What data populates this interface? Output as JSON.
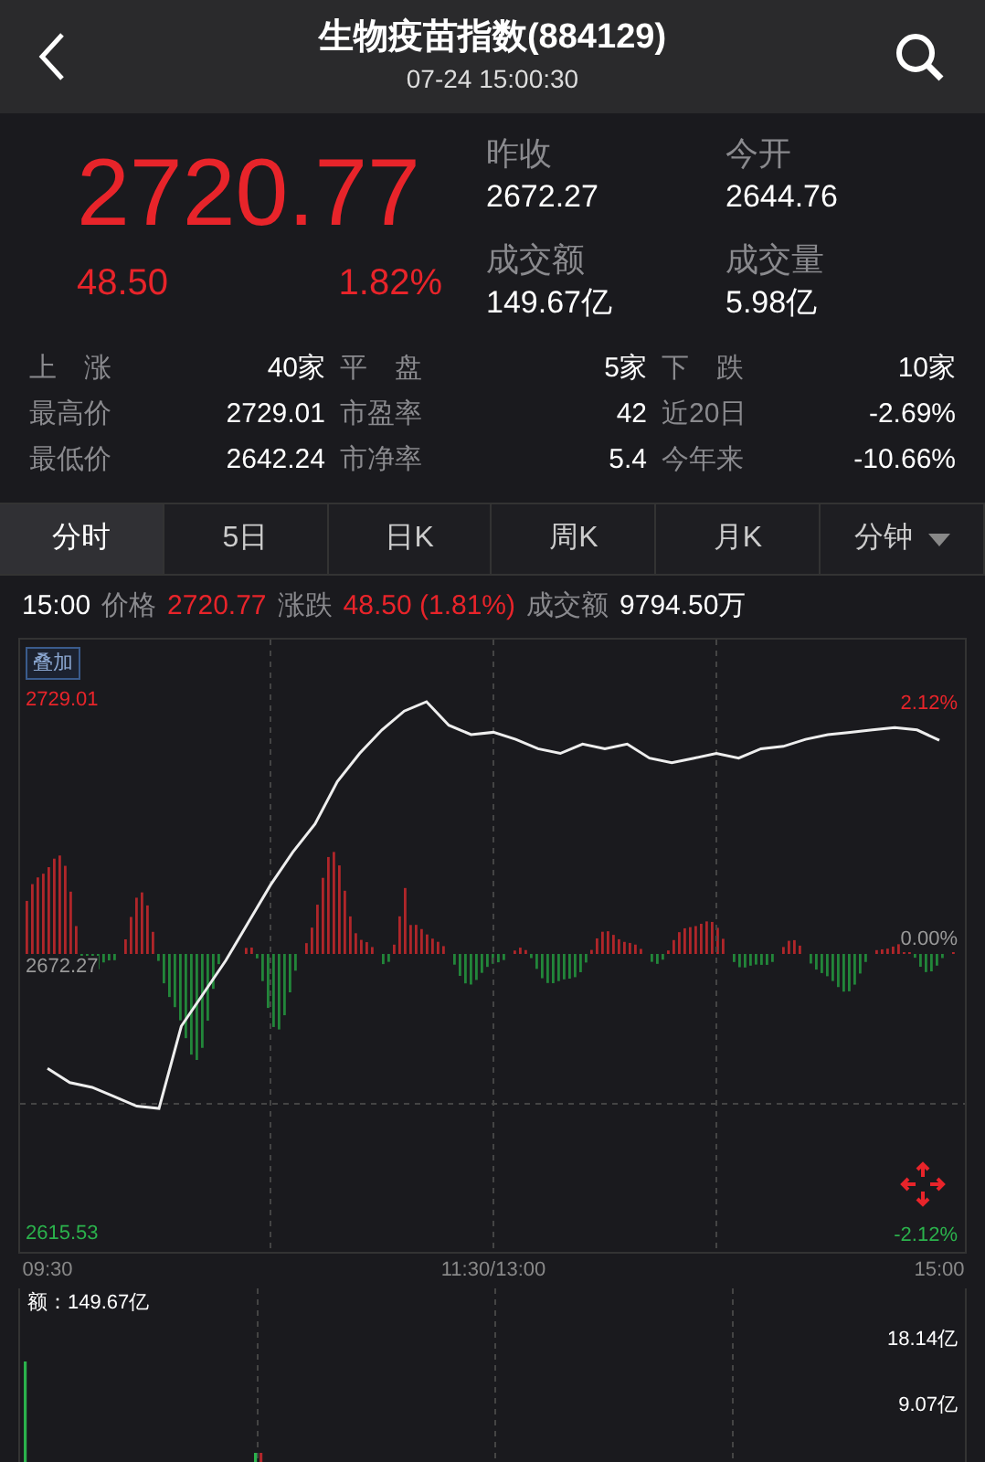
{
  "header": {
    "title": "生物疫苗指数(884129)",
    "datetime": "07-24 15:00:30"
  },
  "quote": {
    "price": "2720.77",
    "change": "48.50",
    "change_pct": "1.82%"
  },
  "stats": [
    {
      "label": "昨收",
      "value": "2672.27"
    },
    {
      "label": "今开",
      "value": "2644.76"
    },
    {
      "label": "成交额",
      "value": "149.67亿"
    },
    {
      "label": "成交量",
      "value": "5.98亿"
    }
  ],
  "breadth": [
    [
      {
        "label": "上　涨",
        "value": "40家"
      },
      {
        "label": "平　盘",
        "value": "5家"
      },
      {
        "label": "下　跌",
        "value": "10家"
      }
    ],
    [
      {
        "label": "最高价",
        "value": "2729.01"
      },
      {
        "label": "市盈率",
        "value": "42"
      },
      {
        "label": "近20日",
        "value": "-2.69%"
      }
    ],
    [
      {
        "label": "最低价",
        "value": "2642.24"
      },
      {
        "label": "市净率",
        "value": "5.4"
      },
      {
        "label": "今年来",
        "value": "-10.66%"
      }
    ]
  ],
  "tabs": [
    {
      "label": "分时",
      "selected": true,
      "kind": "tab"
    },
    {
      "label": "5日",
      "selected": false,
      "kind": "tab"
    },
    {
      "label": "日K",
      "selected": false,
      "kind": "tab"
    },
    {
      "label": "周K",
      "selected": false,
      "kind": "tab"
    },
    {
      "label": "月K",
      "selected": false,
      "kind": "tab"
    },
    {
      "label": "分钟",
      "selected": false,
      "kind": "dropdown"
    }
  ],
  "info": {
    "time": "15:00",
    "price_label": "价格",
    "price": "2720.77",
    "change_label": "涨跌",
    "change": "48.50 (1.81%)",
    "amount_label": "成交额",
    "amount": "9794.50万"
  },
  "chart": {
    "overlay_button": "叠加",
    "top_pct": "2.12%",
    "mid_pct": "0.00%",
    "bottom_pct": "-2.12%",
    "chart_data": {
      "type": "line",
      "categories": [
        "09:30",
        null,
        null,
        null,
        null,
        null,
        null,
        null,
        null,
        null,
        null,
        null,
        null,
        null,
        null,
        null,
        null,
        null,
        null,
        null,
        "11:30/13:00",
        null,
        null,
        null,
        null,
        null,
        null,
        null,
        null,
        null,
        null,
        null,
        null,
        null,
        null,
        null,
        null,
        null,
        null,
        null,
        "15:00"
      ],
      "series": [
        {
          "color": "#eeeeee",
          "values": [
            2651,
            2648,
            2647,
            2645,
            2643,
            2642.5,
            2660,
            2667,
            2674,
            2682,
            2690,
            2697,
            2703,
            2712,
            2718,
            2723,
            2727,
            2729,
            2724,
            2722,
            2722.5,
            2721,
            2719,
            2718,
            2720,
            2719,
            2720,
            2717,
            2716,
            2717,
            2718,
            2717,
            2719,
            2719.5,
            2721,
            2722,
            2722.5,
            2723,
            2723.5,
            2723,
            2720.8
          ]
        }
      ],
      "ylim": [
        2612.4,
        2742.2
      ],
      "grid": true,
      "yticks": [
        2729.01,
        2672.27,
        2615.53
      ]
    }
  },
  "volume": {
    "total": "额：149.67亿",
    "scale": [
      "18.14亿",
      "9.07亿"
    ]
  }
}
